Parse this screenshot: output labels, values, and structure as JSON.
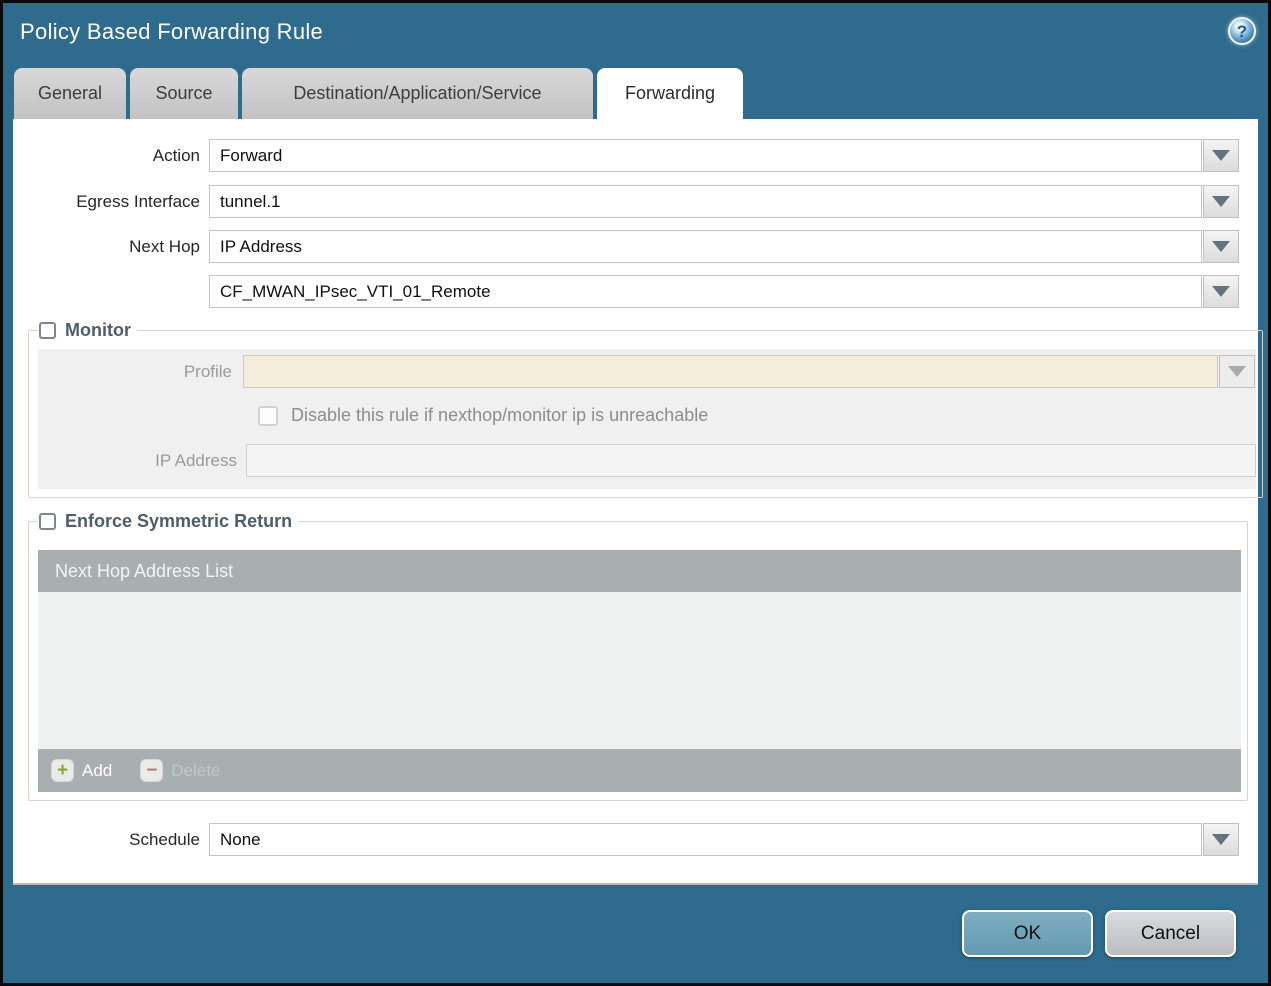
{
  "window": {
    "title": "Policy Based Forwarding Rule",
    "help_glyph": "?"
  },
  "tabs": [
    {
      "label": "General",
      "active": false
    },
    {
      "label": "Source",
      "active": false
    },
    {
      "label": "Destination/Application/Service",
      "active": false
    },
    {
      "label": "Forwarding",
      "active": true
    }
  ],
  "form": {
    "action_label": "Action",
    "action_value": "Forward",
    "egress_label": "Egress Interface",
    "egress_value": "tunnel.1",
    "next_hop_label": "Next Hop",
    "next_hop_value": "IP Address",
    "next_hop_address_value": "CF_MWAN_IPsec_VTI_01_Remote",
    "schedule_label": "Schedule",
    "schedule_value": "None"
  },
  "monitor": {
    "legend": "Monitor",
    "checked": false,
    "profile_label": "Profile",
    "profile_value": "",
    "disable_label": "Disable this rule if nexthop/monitor ip is unreachable",
    "disable_checked": false,
    "ip_label": "IP Address",
    "ip_value": ""
  },
  "symmetric": {
    "legend": "Enforce Symmetric Return",
    "checked": false,
    "table_header": "Next Hop Address List",
    "rows": [],
    "add_label": "Add",
    "add_glyph": "+",
    "delete_label": "Delete",
    "delete_glyph": "−"
  },
  "buttons": {
    "ok": "OK",
    "cancel": "Cancel"
  },
  "colors": {
    "titlebar_teal": "#2f6b8c",
    "active_tab_white": "#ffffff",
    "inactive_tab_gray": "#c8c8c8",
    "ok_button_teal": "#6fa3b9",
    "cancel_button_gray": "#c6c8cc",
    "disabled_input_beige": "#f4eddb",
    "table_header_gray": "#a9aeb1",
    "add_plus_green": "#8ca33b",
    "delete_minus_red": "#c4717c"
  }
}
